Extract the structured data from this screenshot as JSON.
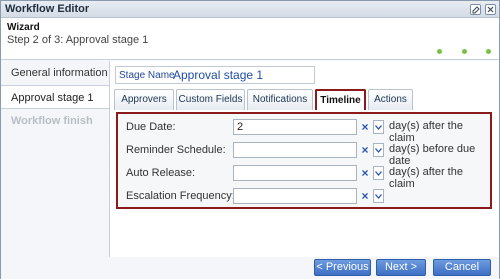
{
  "window": {
    "title": "Workflow Editor",
    "controls": [
      "edit",
      "close"
    ]
  },
  "wizard": {
    "label": "Wizard",
    "step_text": "Step 2 of 3: Approval stage 1",
    "progress_dots": 3,
    "accent_color": "#7ac143"
  },
  "steps": [
    {
      "label": "General information",
      "state": "normal"
    },
    {
      "label": "Approval stage 1",
      "state": "active"
    },
    {
      "label": "Workflow finish",
      "state": "disabled"
    }
  ],
  "stage": {
    "label": "Stage Name",
    "value": "Approval stage 1"
  },
  "tabs": [
    {
      "label": "Approvers",
      "active": false
    },
    {
      "label": "Custom Fields",
      "active": false
    },
    {
      "label": "Notifications",
      "active": false
    },
    {
      "label": "Timeline",
      "active": true
    },
    {
      "label": "Actions",
      "active": false
    }
  ],
  "fields": [
    {
      "label": "Due Date:",
      "value": "2",
      "suffix": "day(s) after the claim"
    },
    {
      "label": "Reminder Schedule:",
      "value": "",
      "suffix": "day(s) before due date"
    },
    {
      "label": "Auto Release:",
      "value": "",
      "suffix": "day(s) after the claim"
    },
    {
      "label": "Escalation Frequency:",
      "value": "",
      "suffix": ""
    }
  ],
  "buttons": {
    "previous": "< Previous",
    "next": "Next >",
    "cancel": "Cancel"
  },
  "colors": {
    "highlight": "#8b1a1a",
    "button": "#3d6ec4"
  }
}
